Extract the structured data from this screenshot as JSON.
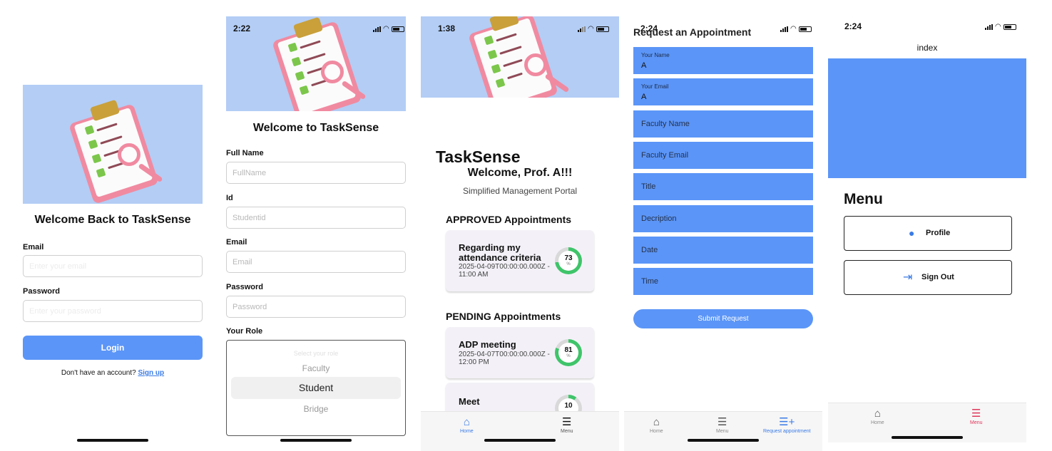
{
  "colors": {
    "accent": "#5b95f7",
    "hero_bg": "#b3cdf5",
    "ring_green": "#3fc46a",
    "menu_active": "#e0355a"
  },
  "login": {
    "title": "Welcome Back to TaskSense",
    "email_label": "Email",
    "email_placeholder": "Enter your email",
    "password_label": "Password",
    "password_placeholder": "Enter your password",
    "login_button": "Login",
    "no_account_text": "Don't have an account?",
    "signup_link": "Sign up"
  },
  "signup": {
    "time": "2:22",
    "title": "Welcome to TaskSense",
    "fullname_label": "Full Name",
    "fullname_placeholder": "FullName",
    "id_label": "Id",
    "id_placeholder": "Studentid",
    "email_label": "Email",
    "email_placeholder": "Email",
    "password_label": "Password",
    "password_placeholder": "Password",
    "role_label": "Your Role",
    "role_picker": {
      "header": "Select your role",
      "options": [
        "Faculty",
        "Student",
        "Bridge"
      ],
      "selected": "Student"
    }
  },
  "dashboard": {
    "time": "1:38",
    "app_name": "TaskSense",
    "welcome": "Welcome, Prof. A!!!",
    "subtitle": "Simplified Management Portal",
    "approved_heading": "APPROVED Appointments",
    "pending_heading": "PENDING Appointments",
    "approved": [
      {
        "title_line1": "Regarding my",
        "title_line2": "attendance criteria",
        "date_line1": "2025-04-09T00:00:00.000Z -",
        "date_line2": "11:00 AM",
        "percent": "73",
        "unit": "%"
      }
    ],
    "pending": [
      {
        "title_line1": "ADP meeting",
        "date_line1": "2025-04-07T00:00:00.000Z -",
        "date_line2": "12:00 PM",
        "percent": "81",
        "unit": "%"
      },
      {
        "title_line1": "Meet",
        "percent": "10"
      }
    ],
    "tabs": {
      "home": "Home",
      "menu": "Menu"
    }
  },
  "request": {
    "time": "2:24",
    "title": "Request an Appointment",
    "name_label": "Your Name",
    "name_value": "A",
    "email_label": "Your Email",
    "email_value": "A",
    "fields": [
      "Faculty Name",
      "Faculty Email",
      "Title",
      "Decription",
      "Date",
      "Time"
    ],
    "submit_button": "Submit Request",
    "tabs": {
      "home": "Home",
      "menu": "Menu",
      "request": "Request appointment"
    }
  },
  "menu_screen": {
    "time": "2:24",
    "header": "index",
    "title": "Menu",
    "profile_button": "Profile",
    "signout_button": "Sign Out",
    "tabs": {
      "home": "Home",
      "menu": "Menu"
    }
  }
}
